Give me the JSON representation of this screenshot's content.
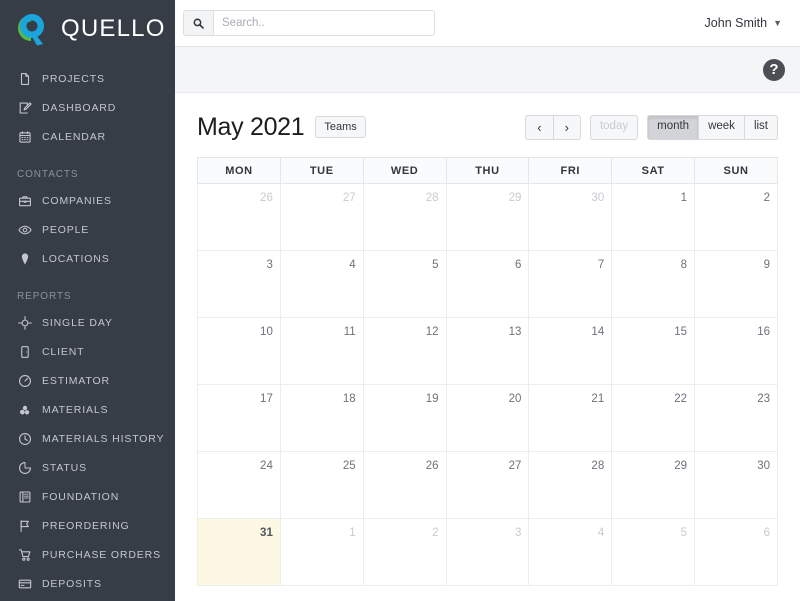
{
  "brand": {
    "name": "QUELLO",
    "logo_icon": "quello-logo-icon",
    "green": "#57ba47",
    "blue": "#1aa6dd",
    "sidebar_bg": "#373d47"
  },
  "sidebar": {
    "groups": [
      {
        "section": null,
        "items": [
          {
            "label": "PROJECTS",
            "icon": "file-icon"
          },
          {
            "label": "DASHBOARD",
            "icon": "edit-square-icon"
          },
          {
            "label": "CALENDAR",
            "icon": "calendar-icon"
          }
        ]
      },
      {
        "section": "CONTACTS",
        "items": [
          {
            "label": "COMPANIES",
            "icon": "briefcase-icon"
          },
          {
            "label": "PEOPLE",
            "icon": "eye-icon"
          },
          {
            "label": "LOCATIONS",
            "icon": "map-pin-icon"
          }
        ]
      },
      {
        "section": "REPORTS",
        "items": [
          {
            "label": "SINGLE DAY",
            "icon": "crosshair-icon"
          },
          {
            "label": "CLIENT",
            "icon": "door-icon"
          },
          {
            "label": "ESTIMATOR",
            "icon": "gauge-icon"
          },
          {
            "label": "MATERIALS",
            "icon": "cubes-icon"
          },
          {
            "label": "MATERIALS HISTORY",
            "icon": "clock-icon"
          },
          {
            "label": "STATUS",
            "icon": "pie-chart-icon"
          },
          {
            "label": "FOUNDATION",
            "icon": "book-open-icon"
          },
          {
            "label": "PREORDERING",
            "icon": "flag-icon"
          },
          {
            "label": "PURCHASE ORDERS",
            "icon": "shopping-cart-icon"
          },
          {
            "label": "DEPOSITS",
            "icon": "credit-card-icon"
          }
        ]
      }
    ]
  },
  "topbar": {
    "search": {
      "icon": "search-icon",
      "value": "",
      "placeholder": "Search.."
    },
    "user": {
      "name": "John Smith",
      "caret_icon": "chevron-down-icon"
    }
  },
  "subbar": {
    "help": {
      "label": "?",
      "icon": "help-circle-icon"
    }
  },
  "calendar": {
    "title": "May 2021",
    "teams_button": "Teams",
    "prev_label": "‹",
    "next_label": "›",
    "today_button": {
      "label": "today",
      "disabled": true
    },
    "views": [
      {
        "label": "month",
        "active": true
      },
      {
        "label": "week",
        "active": false
      },
      {
        "label": "list",
        "active": false
      }
    ],
    "day_headers": [
      "MON",
      "TUE",
      "WED",
      "THU",
      "FRI",
      "SAT",
      "SUN"
    ],
    "today_highlight_color": "#fcf8e3",
    "weeks": [
      [
        {
          "day": "26",
          "other_month": true,
          "today": false
        },
        {
          "day": "27",
          "other_month": true,
          "today": false
        },
        {
          "day": "28",
          "other_month": true,
          "today": false
        },
        {
          "day": "29",
          "other_month": true,
          "today": false
        },
        {
          "day": "30",
          "other_month": true,
          "today": false
        },
        {
          "day": "1",
          "other_month": false,
          "today": false
        },
        {
          "day": "2",
          "other_month": false,
          "today": false
        }
      ],
      [
        {
          "day": "3",
          "other_month": false,
          "today": false
        },
        {
          "day": "4",
          "other_month": false,
          "today": false
        },
        {
          "day": "5",
          "other_month": false,
          "today": false
        },
        {
          "day": "6",
          "other_month": false,
          "today": false
        },
        {
          "day": "7",
          "other_month": false,
          "today": false
        },
        {
          "day": "8",
          "other_month": false,
          "today": false
        },
        {
          "day": "9",
          "other_month": false,
          "today": false
        }
      ],
      [
        {
          "day": "10",
          "other_month": false,
          "today": false
        },
        {
          "day": "11",
          "other_month": false,
          "today": false
        },
        {
          "day": "12",
          "other_month": false,
          "today": false
        },
        {
          "day": "13",
          "other_month": false,
          "today": false
        },
        {
          "day": "14",
          "other_month": false,
          "today": false
        },
        {
          "day": "15",
          "other_month": false,
          "today": false
        },
        {
          "day": "16",
          "other_month": false,
          "today": false
        }
      ],
      [
        {
          "day": "17",
          "other_month": false,
          "today": false
        },
        {
          "day": "18",
          "other_month": false,
          "today": false
        },
        {
          "day": "19",
          "other_month": false,
          "today": false
        },
        {
          "day": "20",
          "other_month": false,
          "today": false
        },
        {
          "day": "21",
          "other_month": false,
          "today": false
        },
        {
          "day": "22",
          "other_month": false,
          "today": false
        },
        {
          "day": "23",
          "other_month": false,
          "today": false
        }
      ],
      [
        {
          "day": "24",
          "other_month": false,
          "today": false
        },
        {
          "day": "25",
          "other_month": false,
          "today": false
        },
        {
          "day": "26",
          "other_month": false,
          "today": false
        },
        {
          "day": "27",
          "other_month": false,
          "today": false
        },
        {
          "day": "28",
          "other_month": false,
          "today": false
        },
        {
          "day": "29",
          "other_month": false,
          "today": false
        },
        {
          "day": "30",
          "other_month": false,
          "today": false
        }
      ],
      [
        {
          "day": "31",
          "other_month": false,
          "today": true
        },
        {
          "day": "1",
          "other_month": true,
          "today": false
        },
        {
          "day": "2",
          "other_month": true,
          "today": false
        },
        {
          "day": "3",
          "other_month": true,
          "today": false
        },
        {
          "day": "4",
          "other_month": true,
          "today": false
        },
        {
          "day": "5",
          "other_month": true,
          "today": false
        },
        {
          "day": "6",
          "other_month": true,
          "today": false
        }
      ]
    ]
  }
}
